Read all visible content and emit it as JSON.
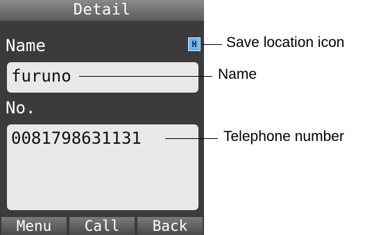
{
  "screen": {
    "title": "Detail",
    "name_label": "Name",
    "save_location_icon": {
      "glyph": "H",
      "icon": "save-location-icon",
      "color": "#6fb4ea"
    },
    "name_value": "furuno",
    "number_label": "No.",
    "number_value": "0081798631131",
    "softkeys": [
      "Menu",
      "Call",
      "Back"
    ]
  },
  "annotations": {
    "save_location": "Save location icon",
    "name": "Name",
    "telephone": "Telephone number"
  }
}
